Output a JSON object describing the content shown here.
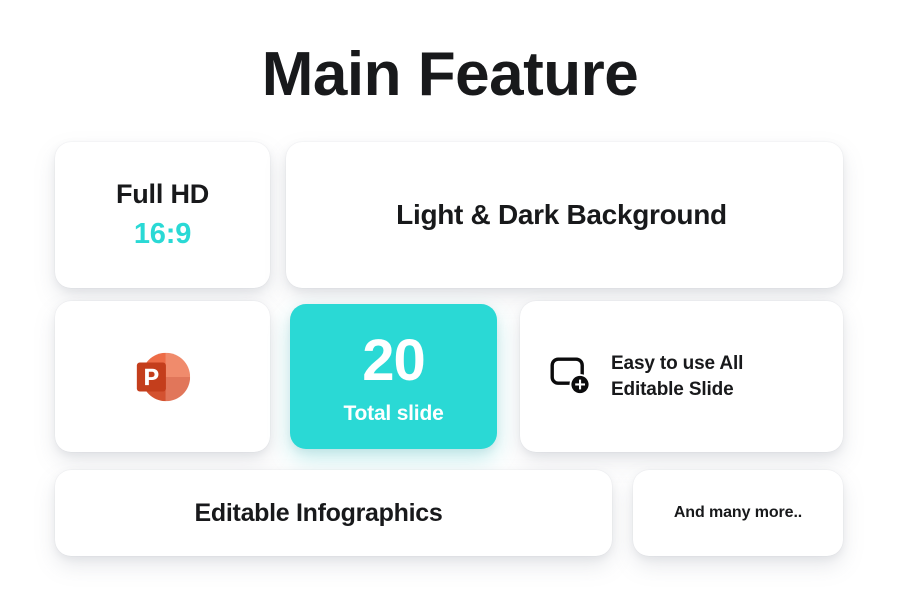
{
  "page": {
    "title": "Main Feature",
    "background_color": "#FFFFFF",
    "accent_color": "#2AD9D5",
    "text_color": "#18191B"
  },
  "cards": {
    "full_hd": {
      "label": "Full HD",
      "ratio": "16:9"
    },
    "light_dark": {
      "label": "Light & Dark Background"
    },
    "powerpoint": {
      "icon": "powerpoint-icon",
      "icon_letter": "P",
      "icon_colors": {
        "circle_light": "#ED6C47",
        "circle_dark": "#D35230",
        "square": "#C43E1C"
      }
    },
    "total_slide": {
      "count": "20",
      "caption": "Total slide",
      "background_color": "#2AD9D5",
      "text_color": "#FFFFFF"
    },
    "easy_use": {
      "icon": "add-slide-icon",
      "line1": "Easy to use All",
      "line2": "Editable Slide"
    },
    "infographics": {
      "label": "Editable Infographics"
    },
    "many_more": {
      "label": "And many more.."
    }
  }
}
